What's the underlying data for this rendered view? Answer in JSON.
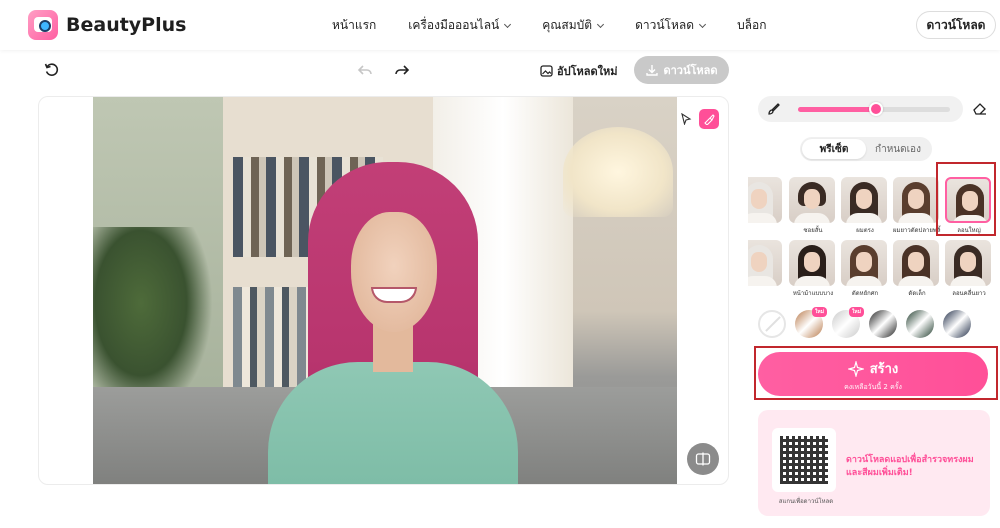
{
  "brand": {
    "name": "BeautyPlus"
  },
  "nav": {
    "items": [
      {
        "label": "หน้าแรก",
        "dropdown": false
      },
      {
        "label": "เครื่องมือออนไลน์",
        "dropdown": true
      },
      {
        "label": "คุณสมบัติ",
        "dropdown": true
      },
      {
        "label": "ดาวน์โหลด",
        "dropdown": true
      },
      {
        "label": "บล็อก",
        "dropdown": false
      }
    ],
    "download_button": "ดาวน์โหลด"
  },
  "toolbar": {
    "upload_new": "อัปโหลดใหม่",
    "download": "ดาวน์โหลด"
  },
  "panel": {
    "brush_size_fraction": 0.51,
    "tabs": [
      {
        "label": "พรีเซ็ต",
        "active": true
      },
      {
        "label": "กำหนดเอง",
        "active": false
      }
    ],
    "styles_row1": [
      "",
      "ซอยสั้น",
      "ผมตรง",
      "ผมยาวดัดปลายพลิ้ว",
      "ลอนใหญ่"
    ],
    "styles_row2": [
      "",
      "หน้าม้าแบบบาง",
      "ดัดหยักศก",
      "ดัดเล็ก",
      "ลอนคลื่นยาว"
    ],
    "selected_style": "ลอนใหญ่",
    "colors": [
      {
        "name": "none",
        "hex": "#ffffff",
        "badge": ""
      },
      {
        "name": "copper",
        "hex": "#b8794a",
        "badge": "ใหม่"
      },
      {
        "name": "silver",
        "hex": "#c8c8c8",
        "badge": "ใหม่"
      },
      {
        "name": "black",
        "hex": "#1e1e1e",
        "badge": ""
      },
      {
        "name": "green-black",
        "hex": "#1f3b2c",
        "badge": ""
      },
      {
        "name": "blue-black",
        "hex": "#1d2a44",
        "badge": ""
      }
    ],
    "create": {
      "label": "สร้าง",
      "sub": "คงเหลือวันนี้ 2 ครั้ง"
    },
    "promo": {
      "caption": "สแกนเพื่อดาวน์โหลด",
      "text": "ดาวน์โหลดแอปเพื่อสำรวจทรงผมและสีผมเพิ่มเติม!"
    }
  },
  "colors": {
    "accent": "#ff4f98",
    "highlight_box": "#c1272d"
  }
}
